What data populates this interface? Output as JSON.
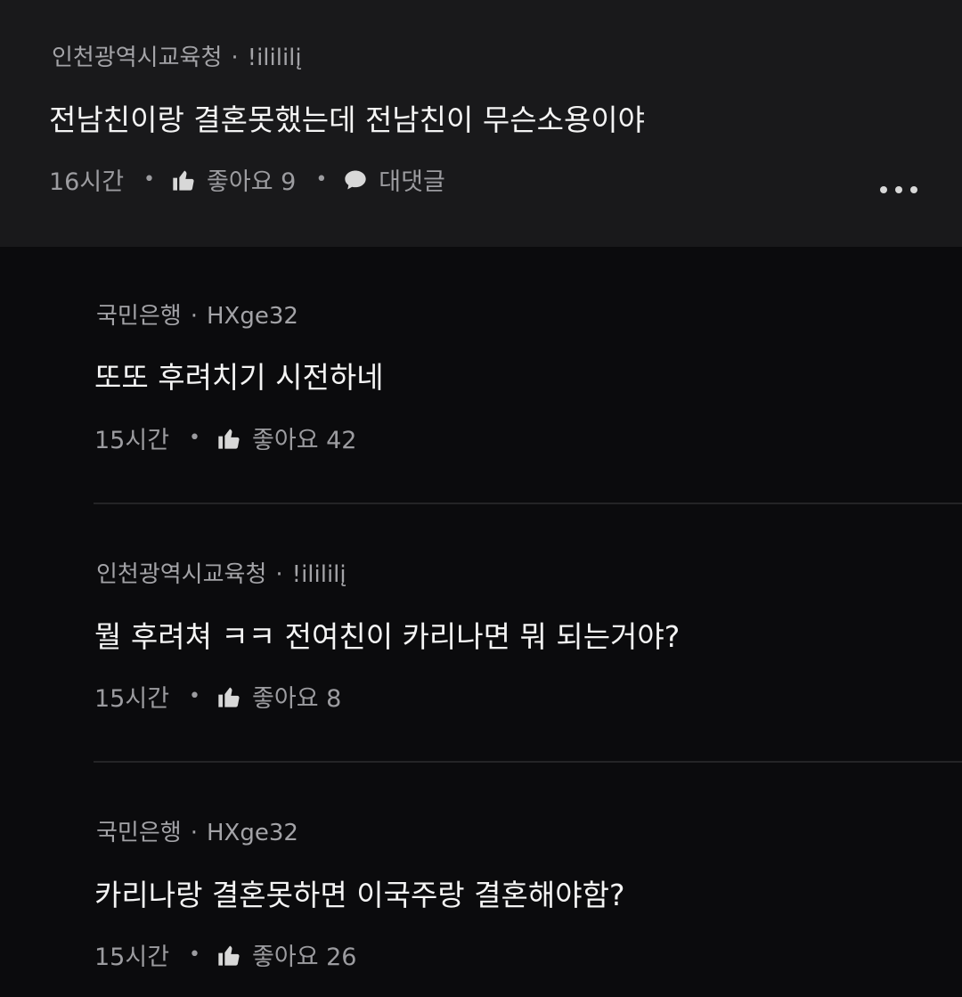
{
  "parent": {
    "author": "인천광역시교육청",
    "handle": "!ilililį",
    "text": "전남친이랑 결혼못했는데 전남친이 무슨소용이야",
    "time": "16시간",
    "like_label": "좋아요 9",
    "reply_label": "대댓글"
  },
  "replies": [
    {
      "author": "국민은행",
      "handle": "HXge32",
      "text": "또또 후려치기 시전하네",
      "time": "15시간",
      "like_label": "좋아요 42"
    },
    {
      "author": "인천광역시교육청",
      "handle": "!ilililį",
      "text": "뭘 후려쳐 ㅋㅋ 전여친이 카리나면 뭐 되는거야?",
      "time": "15시간",
      "like_label": "좋아요 8"
    },
    {
      "author": "국민은행",
      "handle": "HXge32",
      "text": "카리나랑 결혼못하면 이국주랑 결혼해야함?",
      "time": "15시간",
      "like_label": "좋아요 26"
    }
  ],
  "icons": {
    "like": "thumbs-up-icon",
    "reply": "speech-bubble-icon",
    "more": "more-dots-icon"
  },
  "colors": {
    "parent_bg": "#19191b",
    "page_bg": "#0b0b0d",
    "text": "#f4f4f4",
    "muted": "#9c9ca0"
  }
}
